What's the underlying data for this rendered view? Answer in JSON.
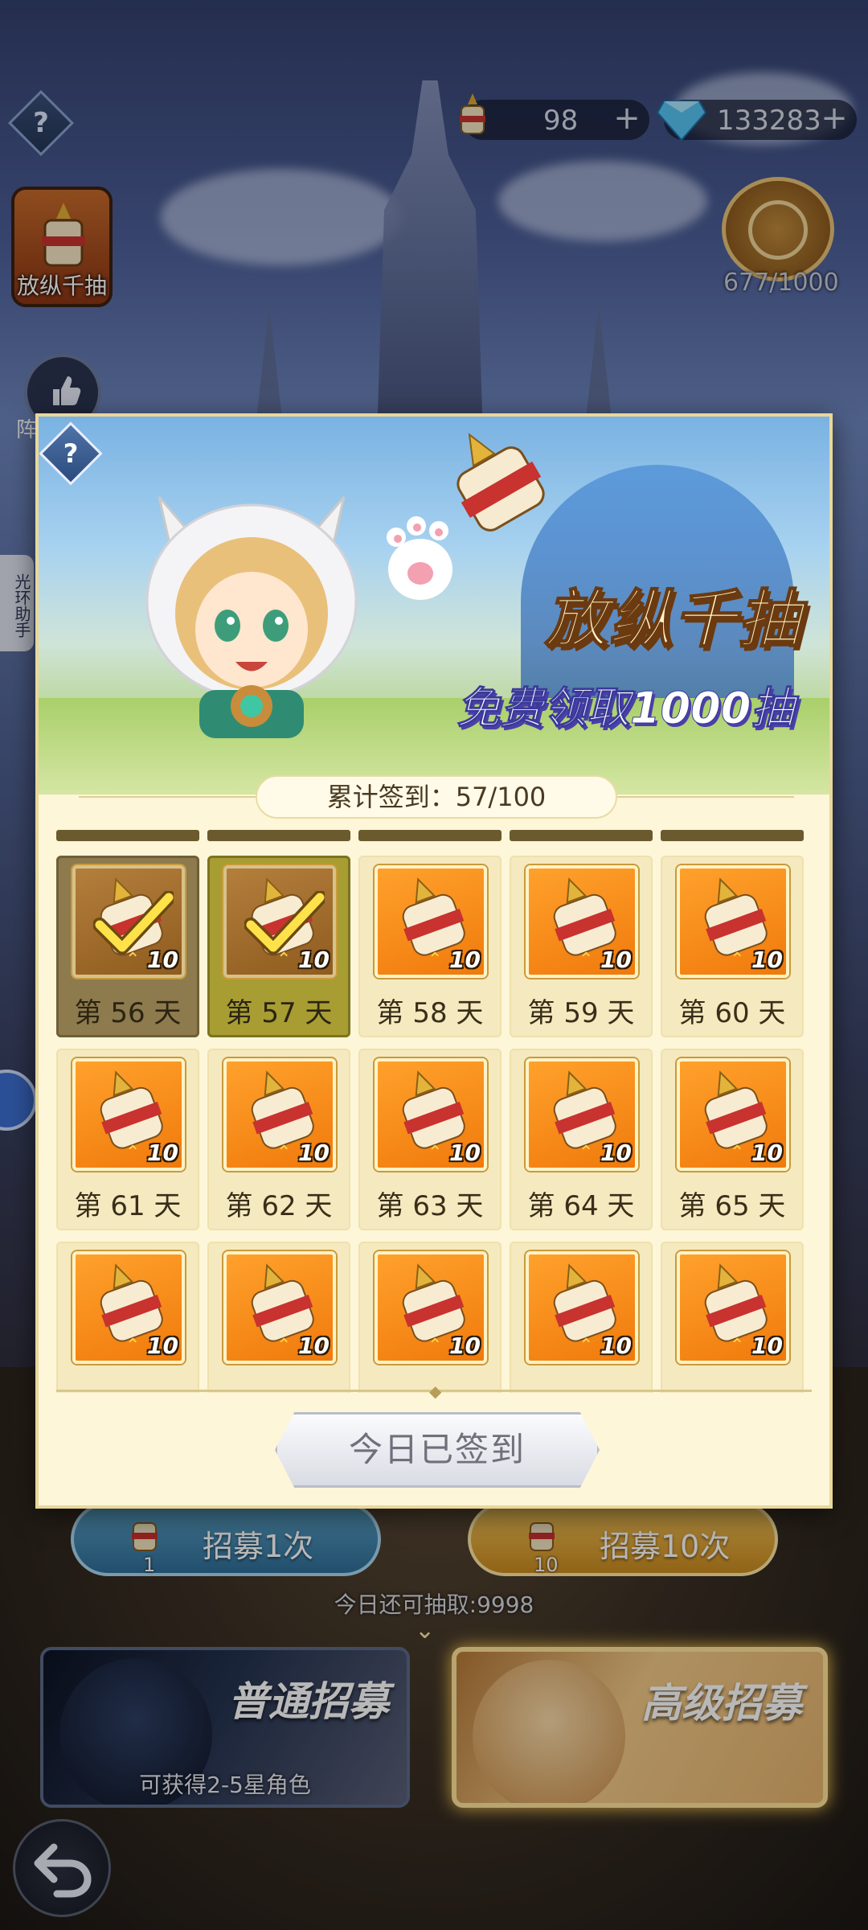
{
  "hud": {
    "scroll_count": "98",
    "gem_count": "133283",
    "help_label": "?",
    "plus_label": "+",
    "side_button_label": "放纵千抽",
    "side_button2_label": "阵容推荐",
    "halo_tab_label": "光环助手",
    "pass_count": "677/1000"
  },
  "popup": {
    "help_label": "?",
    "title": "放纵千抽",
    "subtitle": "免费领取1000抽",
    "progress_label": "累计签到：57/100",
    "status_button": "今日已签到",
    "rows": [
      [
        {
          "day": "第 56 天",
          "qty": "10",
          "state": "done"
        },
        {
          "day": "第 57 天",
          "qty": "10",
          "state": "today"
        },
        {
          "day": "第 58 天",
          "qty": "10",
          "state": "pending"
        },
        {
          "day": "第 59 天",
          "qty": "10",
          "state": "pending"
        },
        {
          "day": "第 60 天",
          "qty": "10",
          "state": "pending"
        }
      ],
      [
        {
          "day": "第 61 天",
          "qty": "10",
          "state": "pending"
        },
        {
          "day": "第 62 天",
          "qty": "10",
          "state": "pending"
        },
        {
          "day": "第 63 天",
          "qty": "10",
          "state": "pending"
        },
        {
          "day": "第 64 天",
          "qty": "10",
          "state": "pending"
        },
        {
          "day": "第 65 天",
          "qty": "10",
          "state": "pending"
        }
      ],
      [
        {
          "day": "",
          "qty": "10",
          "state": "pending"
        },
        {
          "day": "",
          "qty": "10",
          "state": "pending"
        },
        {
          "day": "",
          "qty": "10",
          "state": "pending"
        },
        {
          "day": "",
          "qty": "10",
          "state": "pending"
        },
        {
          "day": "",
          "qty": "10",
          "state": "pending"
        }
      ]
    ]
  },
  "bottom": {
    "recruit_one_label": "招募1次",
    "recruit_one_count": "1",
    "recruit_ten_label": "招募10次",
    "recruit_ten_count": "10",
    "remain_text": "今日还可抽取:9998",
    "normal_pool_title": "普通招募",
    "normal_pool_sub": "可获得2-5星角色",
    "advanced_pool_title": "高级招募"
  },
  "colors": {
    "accent_orange": "#f07a0c",
    "panel_cream": "#fdf6d8",
    "done_cell": "#8d7a4d",
    "today_cell": "#a79d33"
  }
}
